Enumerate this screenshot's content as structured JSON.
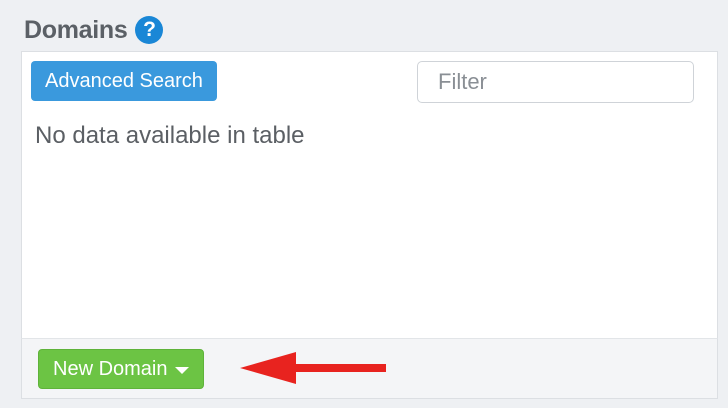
{
  "header": {
    "title": "Domains",
    "help_icon": "?"
  },
  "toolbar": {
    "advanced_search_label": "Advanced Search",
    "filter_placeholder": "Filter",
    "filter_value": ""
  },
  "table": {
    "empty_message": "No data available in table"
  },
  "footer": {
    "new_domain_label": "New Domain"
  },
  "annotation": {
    "arrow_color": "#e8231f",
    "points_to": "new-domain-button"
  },
  "colors": {
    "primary_blue": "#3a99dd",
    "success_green": "#6cc444",
    "help_blue": "#1a87d6"
  }
}
